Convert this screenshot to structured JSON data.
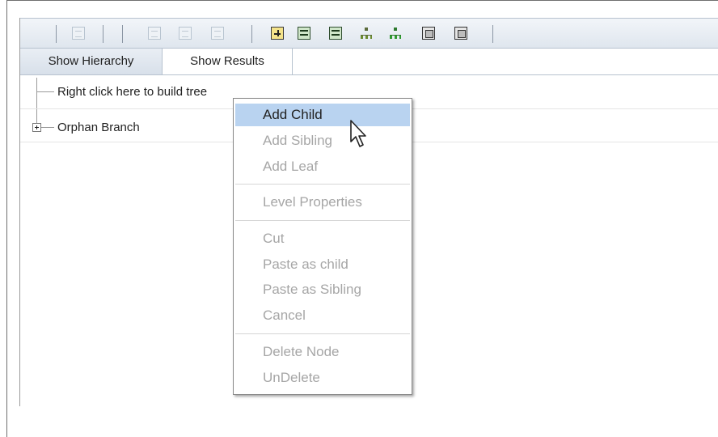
{
  "tabs": [
    {
      "label": "Show Hierarchy",
      "active": true
    },
    {
      "label": "Show Results",
      "active": false
    }
  ],
  "tree": {
    "root_label": "Right click here to build tree",
    "nodes": [
      {
        "label": "Orphan Branch",
        "expander": "plus"
      }
    ]
  },
  "context_menu": {
    "groups": [
      [
        {
          "label": "Add Child",
          "enabled": true,
          "highlighted": true
        },
        {
          "label": "Add Sibling",
          "enabled": false
        },
        {
          "label": "Add Leaf",
          "enabled": false
        }
      ],
      [
        {
          "label": "Level Properties",
          "enabled": false
        }
      ],
      [
        {
          "label": "Cut",
          "enabled": false
        },
        {
          "label": "Paste as child",
          "enabled": false
        },
        {
          "label": "Paste as Sibling",
          "enabled": false
        },
        {
          "label": "Cancel",
          "enabled": false
        }
      ],
      [
        {
          "label": "Delete Node",
          "enabled": false
        },
        {
          "label": "UnDelete",
          "enabled": false
        }
      ]
    ]
  },
  "toolbar": {
    "icons": [
      "view-icon",
      "outdent-icon",
      "indent-icon",
      "move-icon",
      "expand-icon",
      "grid-icon",
      "grid-alt-icon",
      "tree-icon",
      "tree-green-icon",
      "box-icon",
      "box-alt-icon"
    ]
  },
  "colors": {
    "highlight": "#b9d3f0",
    "disabled_text": "#a6a6a6",
    "toolbar_top": "#f2f5f9",
    "toolbar_bottom": "#dfe6ee"
  }
}
